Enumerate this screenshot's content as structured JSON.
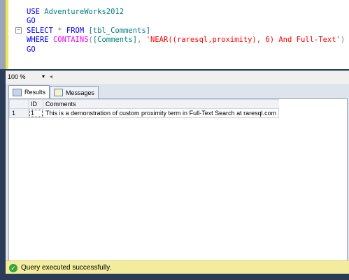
{
  "editor": {
    "lines": [
      {
        "parts": [
          {
            "t": "USE ",
            "c": "kw"
          },
          {
            "t": "AdventureWorks2012",
            "c": "ident"
          }
        ]
      },
      {
        "parts": [
          {
            "t": "GO",
            "c": "kw"
          }
        ]
      },
      {
        "collapse": true,
        "parts": [
          {
            "t": "SELECT",
            "c": "kw"
          },
          {
            "t": " * ",
            "c": "gray"
          },
          {
            "t": "FROM",
            "c": "kw"
          },
          {
            "t": " [tbl_Comments]",
            "c": "ident"
          }
        ]
      },
      {
        "parts": [
          {
            "t": "WHERE ",
            "c": "kw"
          },
          {
            "t": "CONTAINS",
            "c": "fn"
          },
          {
            "t": "(",
            "c": "gray"
          },
          {
            "t": "[Comments]",
            "c": "ident"
          },
          {
            "t": ", ",
            "c": "gray"
          },
          {
            "t": "'NEAR((raresql,proximity), 6) And Full-Text'",
            "c": "str"
          },
          {
            "t": ")",
            "c": "gray"
          }
        ]
      },
      {
        "parts": [
          {
            "t": "GO",
            "c": "kw"
          }
        ]
      }
    ]
  },
  "zoom": {
    "value": "100 %",
    "arrow": "▾",
    "scroll": "◂"
  },
  "tabs": [
    {
      "label": "Results",
      "active": true
    },
    {
      "label": "Messages",
      "active": false
    }
  ],
  "grid": {
    "columns": [
      "ID",
      "Comments"
    ],
    "rows": [
      {
        "num": "1",
        "id": "1",
        "comment": "This is a demonstration of custom proximity term in Full-Text Search at raresql.com"
      }
    ]
  },
  "status": {
    "text": "Query executed successfully.",
    "icon": "check-circle-icon"
  }
}
